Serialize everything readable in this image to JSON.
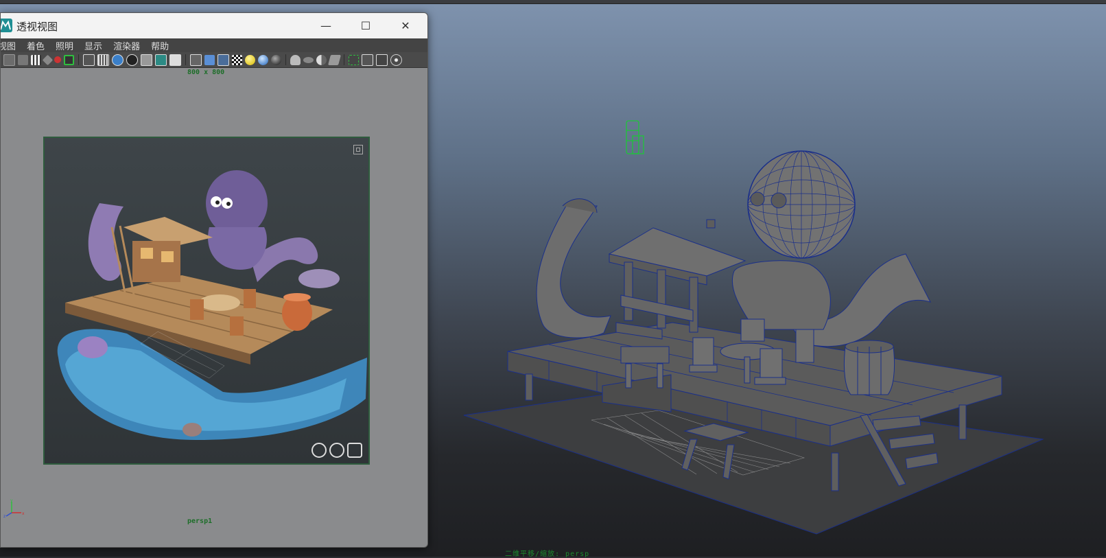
{
  "window": {
    "title": "透视视图",
    "controls": {
      "minimize": "—",
      "maximize": "☐",
      "close": "✕"
    }
  },
  "menubar": {
    "items": [
      "视图",
      "着色",
      "照明",
      "显示",
      "渲染器",
      "帮助"
    ]
  },
  "toolbar": {
    "icons": [
      "camera-attributes-icon",
      "bookmark-icon",
      "film-gate-icon",
      "grid-icon",
      "isolate-icon",
      "frame-icon",
      "wireframe-icon",
      "smooth-shade-icon",
      "texture-icon",
      "lighting-icon",
      "shadow-icon",
      "xray-icon",
      "text-icon",
      "cube-icon",
      "cube-shaded-icon",
      "cube-textured-icon",
      "checker-icon",
      "sphere-yellow-icon",
      "sphere-blue-icon",
      "sphere-dark-icon",
      "head-icon",
      "disc-icon",
      "half-sphere-icon",
      "vase-icon",
      "select-camera-icon",
      "box-icon",
      "boxes-icon",
      "share-icon"
    ]
  },
  "viewport_inner": {
    "resolution": "800 x 800",
    "camera_name": "persp1"
  },
  "main_viewport": {
    "camera_label_prefix": "二维平移/缩放:",
    "camera_name": "persp"
  },
  "colors": {
    "hud_green": "#1d6e29",
    "mesh_gray": "#6a6a6a",
    "wire_blue": "#1a2f8a",
    "selection_green": "#1ec53a"
  }
}
